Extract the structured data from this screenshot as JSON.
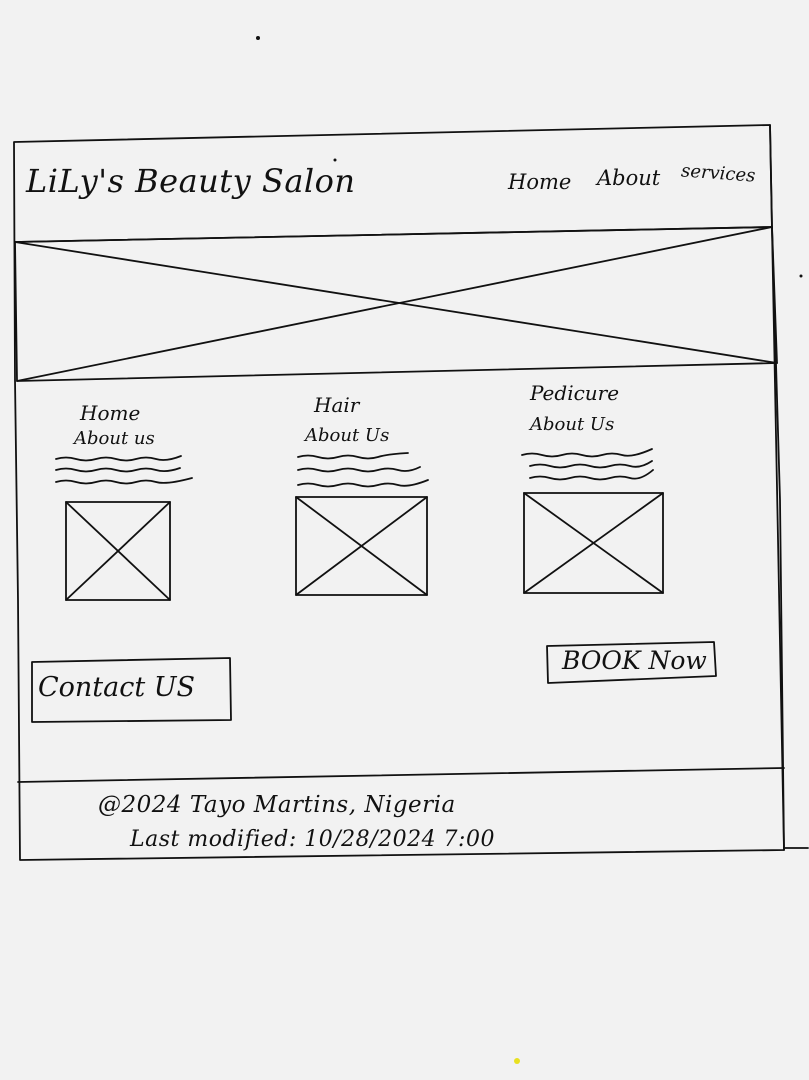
{
  "header": {
    "logo_text": "LiLy's Beauty Salon",
    "nav": [
      {
        "label": "Home"
      },
      {
        "label": "About"
      },
      {
        "label": "services"
      }
    ]
  },
  "cards": [
    {
      "title": "Home",
      "subtitle": "About us"
    },
    {
      "title": "Hair",
      "subtitle": "About Us"
    },
    {
      "title": "Pedicure",
      "subtitle": "About Us"
    }
  ],
  "buttons": {
    "contact_label": "Contact US",
    "book_label": "BOOK Now"
  },
  "footer": {
    "copyright": "@2024 Tayo Martins, Nigeria",
    "last_modified": "Last modified: 10/28/2024   7:00"
  }
}
